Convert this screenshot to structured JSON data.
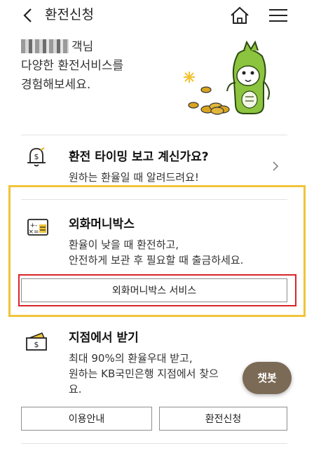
{
  "header": {
    "title": "환전신청"
  },
  "greeting": {
    "name_suffix": "객님",
    "line2": "다양한 환전서비스를",
    "line3": "경험해보세요."
  },
  "sections": {
    "timing": {
      "title": "환전 타이밍 보고 계신가요?",
      "desc": "원하는 환율일 때 알려드려요!"
    },
    "moneybox": {
      "title": "외화머니박스",
      "desc1": "환율이 낮을 때 환전하고,",
      "desc2": "안전하게 보관 후 필요할 때 출금하세요.",
      "button": "외화머니박스 서비스"
    },
    "branch": {
      "title": "지점에서 받기",
      "desc1": "최대 90%의 환율우대 받고,",
      "desc2": "원하는 KB국민은행 지점에서 찾으",
      "desc3": "요.",
      "button_guide": "이용안내",
      "button_apply": "환전신청"
    }
  },
  "chatbot": {
    "label": "챗봇"
  },
  "colors": {
    "highlight_yellow": "#f0c43a",
    "highlight_red": "#d8252a",
    "chatbot_bg": "#7b6a55",
    "mascot_green": "#8cc43f"
  }
}
